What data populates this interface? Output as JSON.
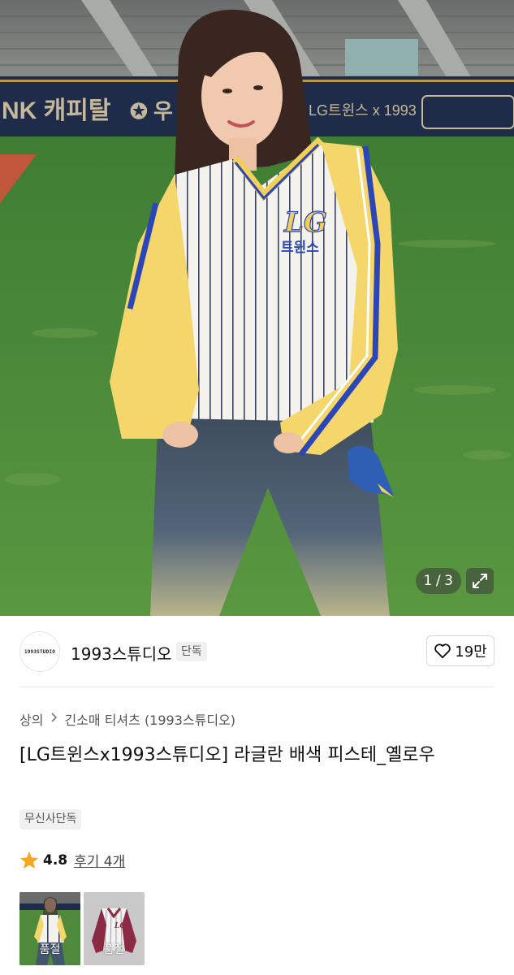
{
  "hero": {
    "counter_current": "1",
    "counter_sep": "/",
    "counter_total": "3",
    "expand_icon": "expand-icon"
  },
  "brand": {
    "logo_text": "1993STUDIO",
    "name": "1993스튜디오",
    "badge": "단독",
    "like_icon": "heart-icon",
    "like_count": "19만"
  },
  "product": {
    "breadcrumb": [
      "상의",
      "긴소매 티셔츠 (1993스튜디오)"
    ],
    "title": "[LG트윈스x1993스튜디오] 라글란 배색 피스테_옐로우",
    "tag": "무신사단독",
    "rating": "4.8",
    "reviews_label": "후기 4개"
  },
  "thumbnails": [
    {
      "label": "품절",
      "selected": true
    },
    {
      "label": "품절",
      "selected": false
    }
  ],
  "colors": {
    "star": "#f5a623",
    "jersey_yellow": "#f4d66b",
    "jersey_stripe": "#2c46b8",
    "grass": "#4f8a3c"
  }
}
